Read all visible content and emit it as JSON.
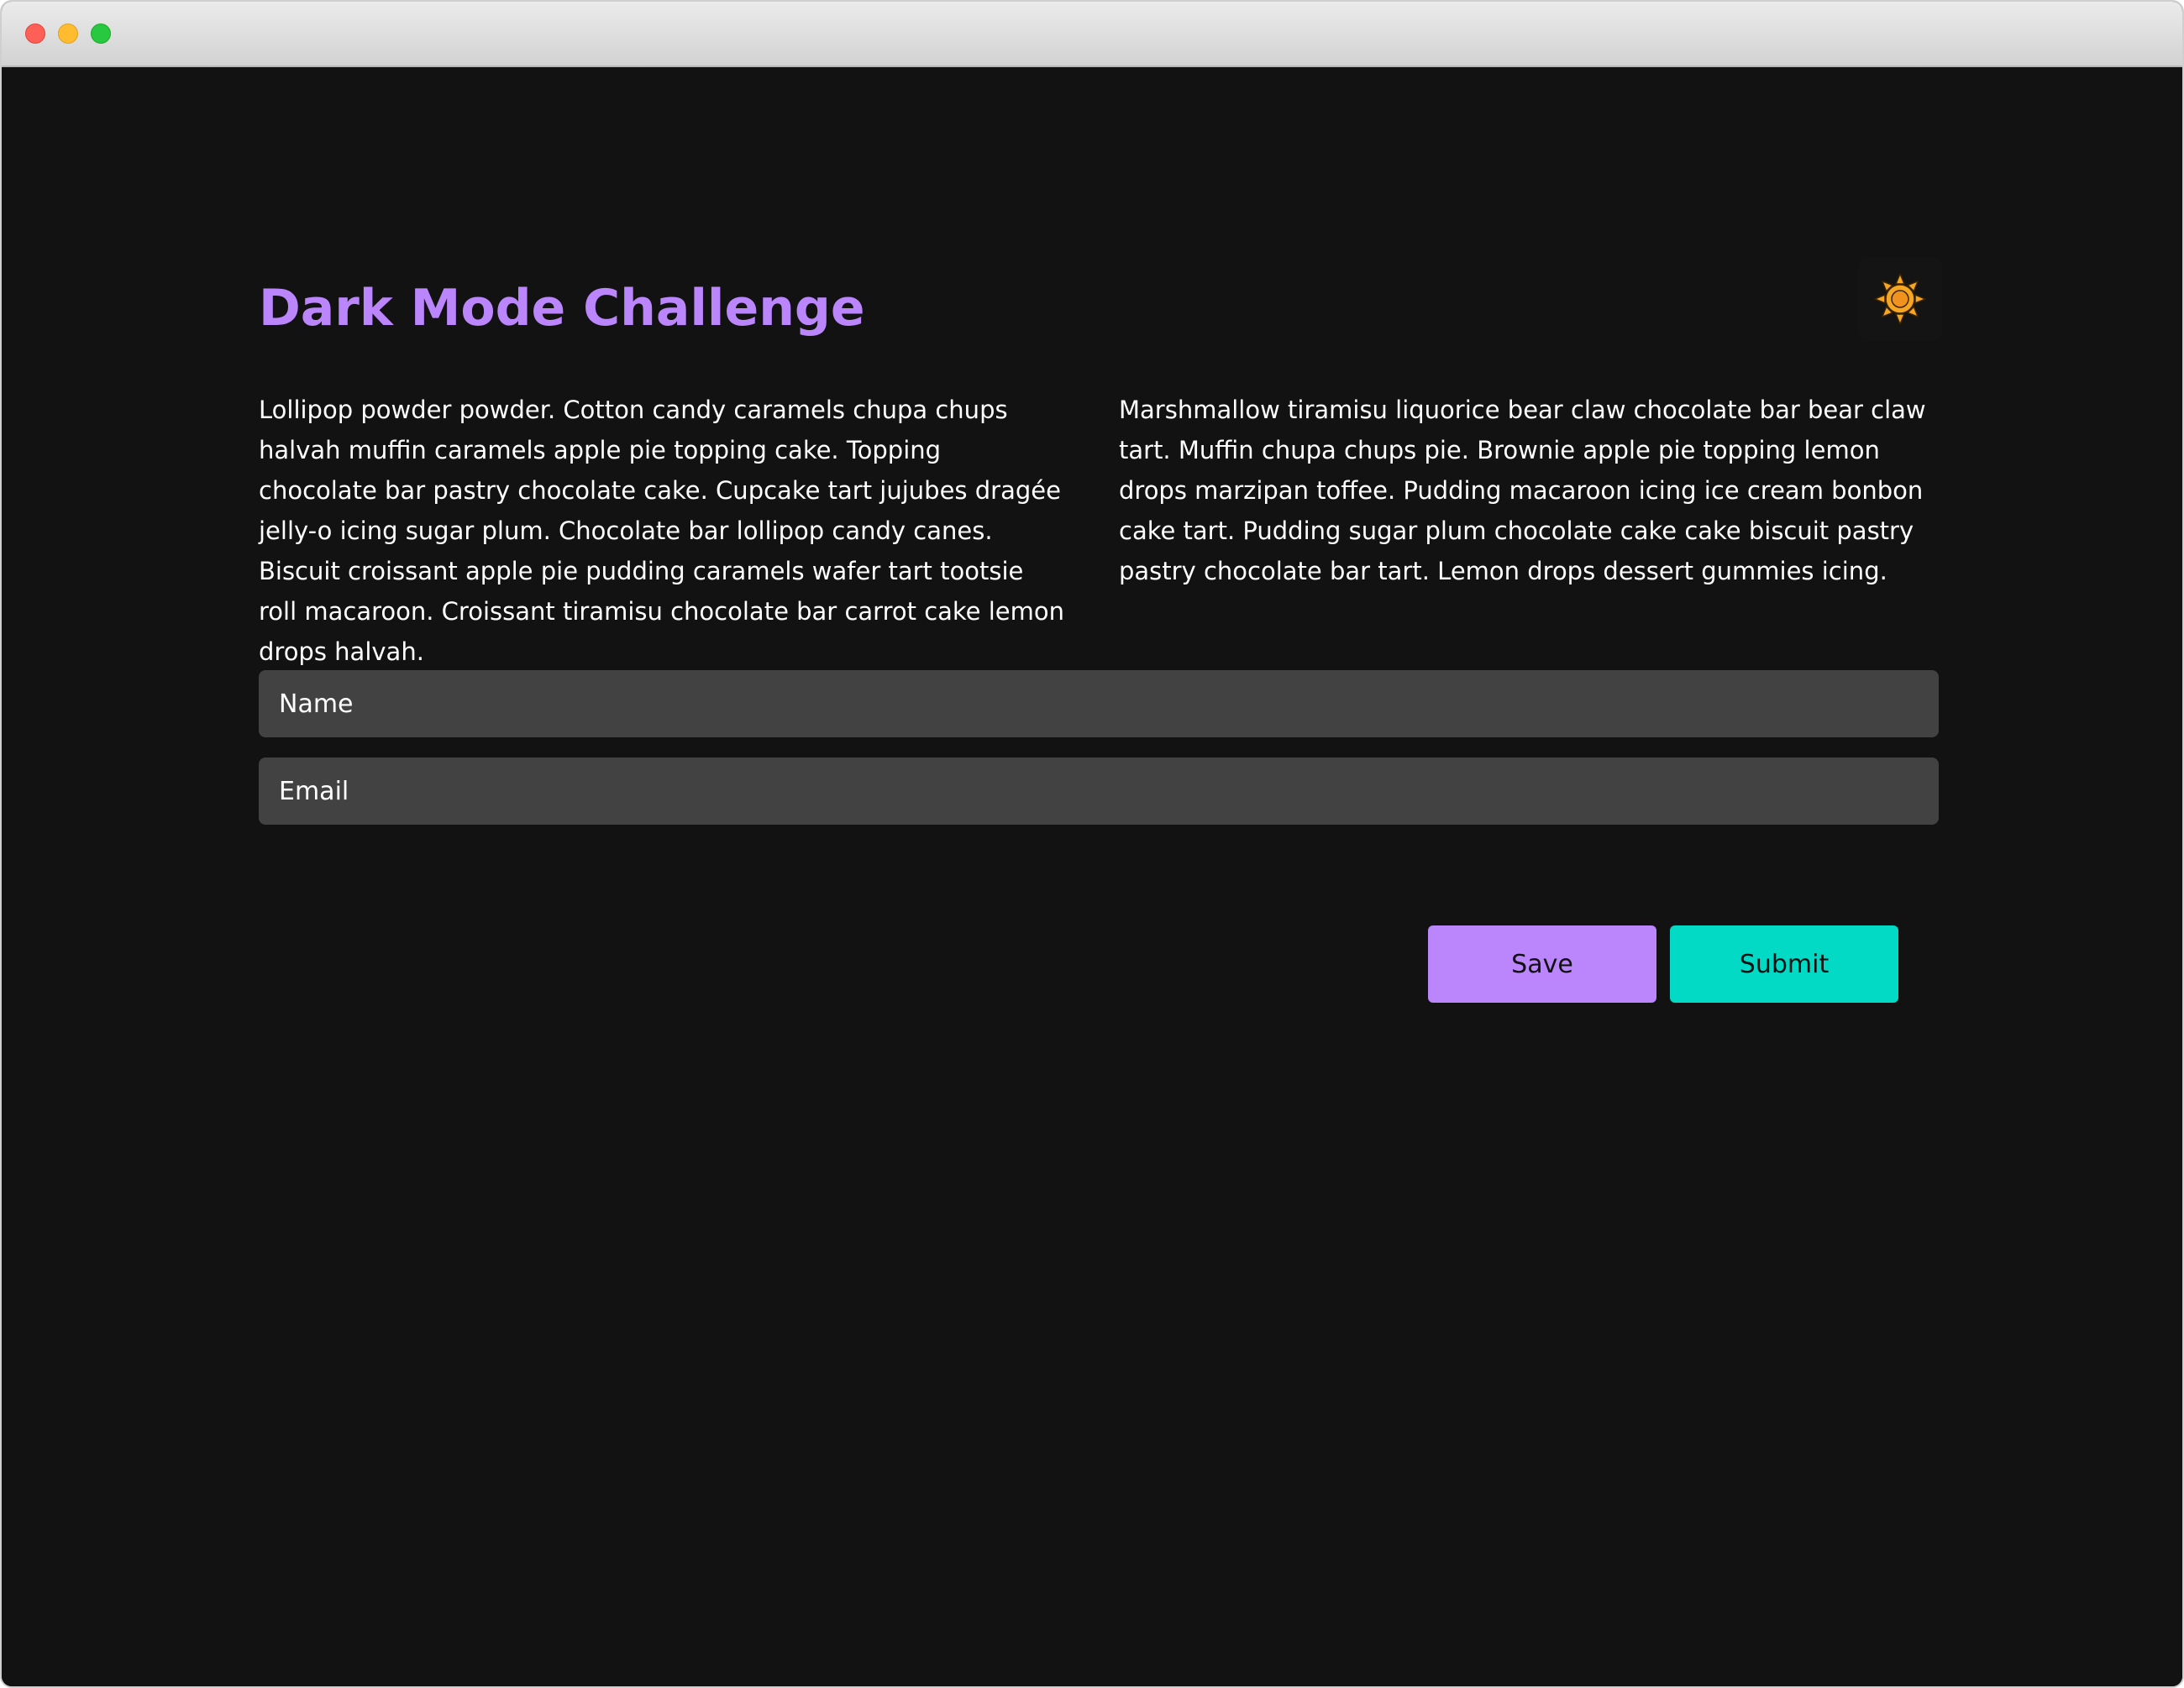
{
  "window": {
    "controls": [
      "close",
      "minimize",
      "zoom"
    ]
  },
  "page": {
    "title": "Dark Mode Challenge",
    "theme_toggle_icon": "sun-icon",
    "paragraphs": [
      "Lollipop powder powder. Cotton candy caramels chupa chups halvah muffin caramels apple pie topping cake. Topping chocolate bar pastry chocolate cake. Cupcake tart jujubes dragée jelly-o icing sugar plum. Chocolate bar lollipop candy canes. Biscuit croissant apple pie pudding caramels wafer tart tootsie roll macaroon. Croissant tiramisu chocolate bar carrot cake lemon drops halvah.",
      "Marshmallow tiramisu liquorice bear claw chocolate bar bear claw tart. Muffin chupa chups pie. Brownie apple pie topping lemon drops marzipan toffee. Pudding macaroon icing ice cream bonbon cake tart. Pudding sugar plum chocolate cake cake biscuit pastry pastry chocolate bar tart. Lemon drops dessert gummies icing."
    ]
  },
  "form": {
    "name_placeholder": "Name",
    "name_value": "",
    "email_placeholder": "Email",
    "email_value": "",
    "save_label": "Save",
    "submit_label": "Submit"
  },
  "colors": {
    "background": "#121212",
    "accent_primary": "#bb86fc",
    "accent_secondary": "#03dac6",
    "input_background": "#424242",
    "sun": "#f5a623"
  }
}
